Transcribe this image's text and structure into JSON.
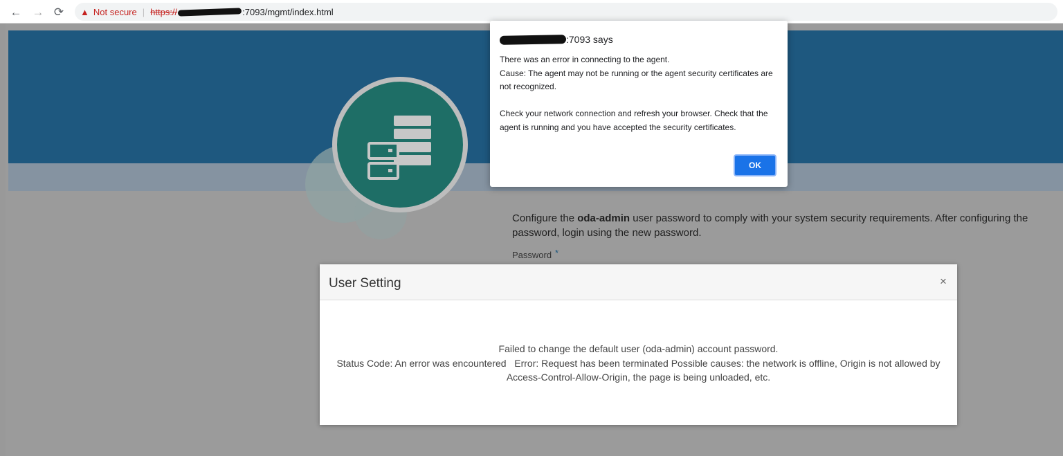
{
  "browser": {
    "back_icon": "←",
    "forward_icon": "→",
    "reload_icon": "⟳",
    "warning_icon": "▲",
    "security_label": "Not secure",
    "url_scheme": "https://",
    "url_rest": ":7093/mgmt/index.html"
  },
  "page": {
    "config_prefix": "Configure the ",
    "config_user": "oda-admin",
    "config_suffix": " user password to comply with your system security requirements. After configuring the password, login using the new password.",
    "password_label": "Password",
    "required_mark": "*",
    "colors": {
      "banner": "#1e587f",
      "logo": "#1e6e66"
    }
  },
  "alert": {
    "origin_suffix": ":7093 says",
    "message": "There was an error in connecting to the agent.\nCause: The agent may not be running or the agent security certificates are not recognized.\n\nCheck your network connection and refresh your browser. Check that the agent is running and you have accepted the security certificates.",
    "ok_label": "OK",
    "accent": "#1a73e8"
  },
  "modal": {
    "title": "User Setting",
    "close_icon": "×",
    "line1": "Failed to change the default user (oda-admin) account password.",
    "line2": "Status Code: An error was encountered   Error: Request has been terminated Possible causes: the network is offline, Origin is not allowed by Access-Control-Allow-Origin, the page is being unloaded, etc."
  }
}
